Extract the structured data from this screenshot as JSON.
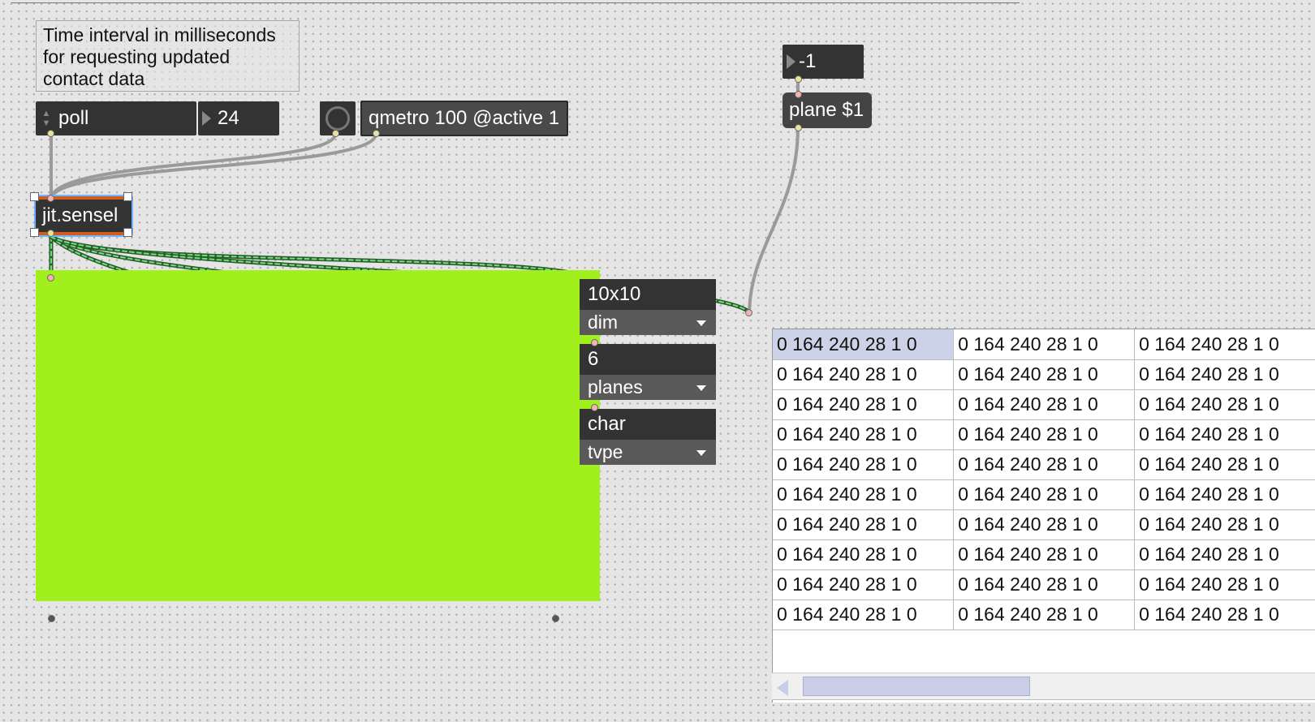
{
  "comment": {
    "lines": [
      "Time interval in milliseconds",
      "for requesting updated",
      "contact data"
    ]
  },
  "objects": {
    "poll_label": "poll",
    "poll_number": "24",
    "qmetro_label": "qmetro 100 @active 1",
    "sensel_label": "jit.sensel",
    "plane_number": "-1",
    "plane_message": "plane $1"
  },
  "attrui": [
    {
      "value": "10x10",
      "name": "dim"
    },
    {
      "value": "6",
      "name": "planes"
    },
    {
      "value": "char",
      "name": "tvpe"
    }
  ],
  "cellblock": {
    "rows": [
      [
        "0 164 240 28 1 0",
        "0 164 240 28 1 0",
        "0 164 240 28 1 0"
      ],
      [
        "0 164 240 28 1 0",
        "0 164 240 28 1 0",
        "0 164 240 28 1 0"
      ],
      [
        "0 164 240 28 1 0",
        "0 164 240 28 1 0",
        "0 164 240 28 1 0"
      ],
      [
        "0 164 240 28 1 0",
        "0 164 240 28 1 0",
        "0 164 240 28 1 0"
      ],
      [
        "0 164 240 28 1 0",
        "0 164 240 28 1 0",
        "0 164 240 28 1 0"
      ],
      [
        "0 164 240 28 1 0",
        "0 164 240 28 1 0",
        "0 164 240 28 1 0"
      ],
      [
        "0 164 240 28 1 0",
        "0 164 240 28 1 0",
        "0 164 240 28 1 0"
      ],
      [
        "0 164 240 28 1 0",
        "0 164 240 28 1 0",
        "0 164 240 28 1 0"
      ],
      [
        "0 164 240 28 1 0",
        "0 164 240 28 1 0",
        "0 164 240 28 1 0"
      ],
      [
        "0 164 240 28 1 0",
        "0 164 240 28 1 0",
        "0 164 240 28 1 0"
      ]
    ]
  },
  "colors": {
    "canvas": "#e5e5e5",
    "object_bg": "#333333",
    "display_fill": "#a1f01e",
    "selection": "#6fb4ff",
    "matrix_cord": "#4fd06a"
  }
}
